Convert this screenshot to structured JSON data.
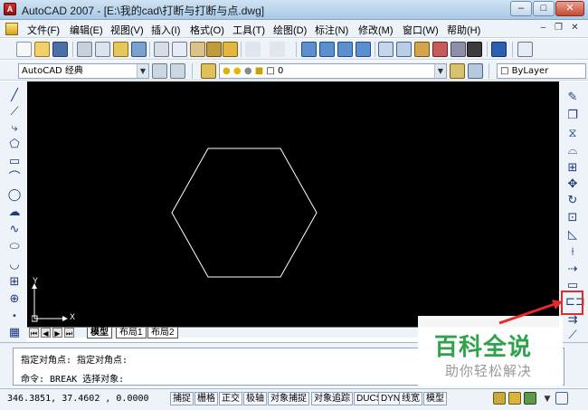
{
  "window": {
    "title": "AutoCAD 2007 - [E:\\我的cad\\打断与打断与点.dwg]",
    "minimize": "–",
    "maximize": "□",
    "close": "✕"
  },
  "menubar": {
    "items": [
      "文件(F)",
      "编辑(E)",
      "视图(V)",
      "插入(I)",
      "格式(O)",
      "工具(T)",
      "绘图(D)",
      "标注(N)",
      "修改(M)",
      "窗口(W)",
      "帮助(H)"
    ],
    "mdi_minimize": "–",
    "mdi_restore": "❐",
    "mdi_close": "✕"
  },
  "workspace": {
    "selected": "AutoCAD 经典"
  },
  "layer": {
    "selected": "0"
  },
  "color_control": {
    "selected": "ByLayer"
  },
  "ucs": {
    "x_label": "X",
    "y_label": "Y"
  },
  "layout_tabs": [
    "模型",
    "布局1",
    "布局2"
  ],
  "command_lines": [
    "指定对角点: 指定对角点:",
    "命令:  BREAK 选择对象:"
  ],
  "status": {
    "coordinates": "346.3851, 37.4602 , 0.0000",
    "toggles": [
      "捕捉",
      "栅格",
      "正交",
      "极轴",
      "对象捕捉",
      "对象追踪",
      "DUCS",
      "DYN",
      "线宽",
      "模型"
    ]
  },
  "watermark": {
    "title": "百科全说",
    "subtitle": "助你轻松解决"
  },
  "colors": {
    "canvas_bg": "#000000",
    "hexagon_stroke": "#ffffff",
    "highlight": "#e52a2a",
    "watermark_green": "#2ea34a"
  }
}
